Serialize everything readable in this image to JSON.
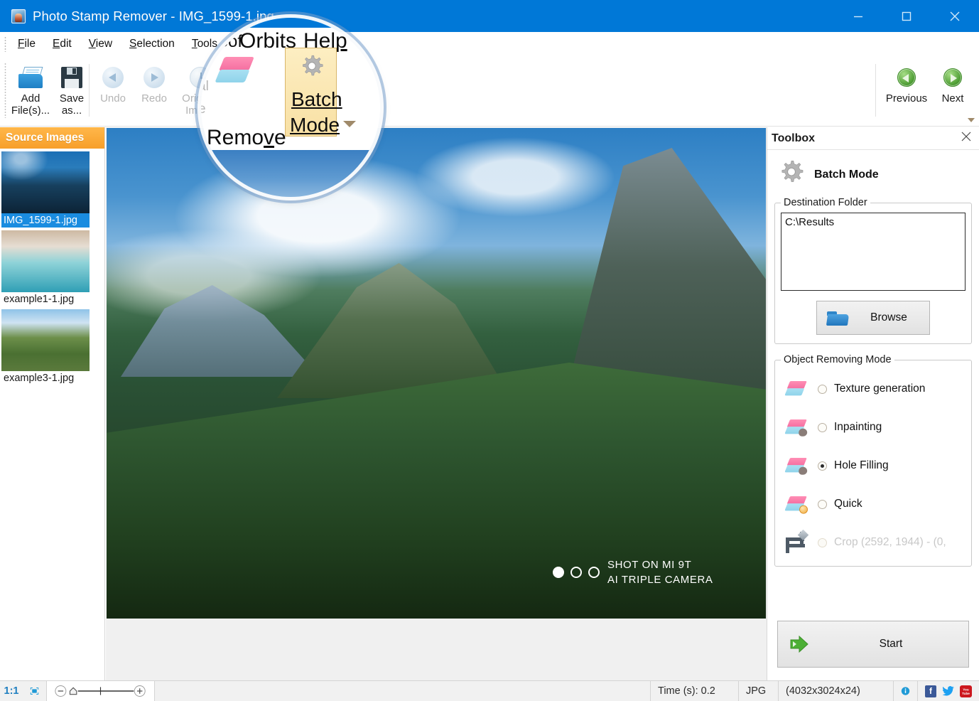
{
  "window": {
    "title": "Photo Stamp Remover - IMG_1599-1.jpg",
    "icon": "app-photo-icon",
    "minimize": "minimize-icon",
    "maximize": "maximize-icon",
    "close": "close-icon",
    "titlebar_color": "#0078d7"
  },
  "menu": {
    "items": [
      {
        "label": "File",
        "accel": "F"
      },
      {
        "label": "Edit",
        "accel": "E"
      },
      {
        "label": "View",
        "accel": "V"
      },
      {
        "label": "Selection",
        "accel": "S"
      },
      {
        "label": "Tools",
        "accel": "T"
      },
      {
        "label": "SoftOrbits",
        "accel": ""
      },
      {
        "label": "Help",
        "accel": "H"
      }
    ]
  },
  "ribbon": {
    "buttons": [
      {
        "name": "add-files",
        "label": "Add\nFile(s)...",
        "icon": "add-files-icon",
        "disabled": false
      },
      {
        "name": "save-as",
        "label": "Save\nas...",
        "icon": "save-icon",
        "disabled": false
      },
      {
        "name": "undo",
        "label": "Undo",
        "icon": "undo-arrow-icon",
        "disabled": true
      },
      {
        "name": "redo",
        "label": "Redo",
        "icon": "redo-arrow-icon",
        "disabled": true
      },
      {
        "name": "original-image",
        "label": "Original\nImage",
        "icon": "clock-icon",
        "disabled": true
      },
      {
        "name": "remove",
        "label": "Remove",
        "icon": "eraser-icon",
        "disabled": false
      },
      {
        "name": "batch-mode",
        "label": "Batch\nMode",
        "icon": "gear-icon",
        "disabled": false
      },
      {
        "name": "previous",
        "label": "Previous",
        "icon": "green-left-arrow-icon",
        "disabled": false
      },
      {
        "name": "next",
        "label": "Next",
        "icon": "green-right-arrow-icon",
        "disabled": false
      }
    ],
    "expand": "ribbon-expand-chevron"
  },
  "magnifier": {
    "menu_fragment_left": "s",
    "menu_fragment_soft": "Sof",
    "menu_orbits": "Orbits",
    "menu_help": "Help",
    "ghost_original": "al",
    "ghost_image": "e",
    "remove_label": "Remove",
    "batch_line1": "Batch",
    "batch_line2": "Mode"
  },
  "source_panel": {
    "header": "Source Images",
    "items": [
      {
        "label": "IMG_1599-1.jpg",
        "selected": true,
        "thumb": "th1"
      },
      {
        "label": "example1-1.jpg",
        "selected": false,
        "thumb": "th2"
      },
      {
        "label": "example3-1.jpg",
        "selected": false,
        "thumb": "th3"
      }
    ]
  },
  "photo": {
    "watermark_line1": "SHOT ON MI 9T",
    "watermark_line2": "AI TRIPLE CAMERA",
    "dots": [
      true,
      false,
      false
    ]
  },
  "toolbox": {
    "title": "Toolbox",
    "close_icon": "close-icon",
    "mode_icon": "gear-icon",
    "mode_name": "Batch Mode",
    "destination": {
      "legend": "Destination Folder",
      "value": "C:\\Results",
      "browse_label": "Browse",
      "browse_icon": "folder-icon"
    },
    "object_removing_mode": {
      "legend": "Object Removing Mode",
      "options": [
        {
          "label": "Texture generation",
          "selected": false,
          "disabled": false,
          "icon": "eraser-icon"
        },
        {
          "label": "Inpainting",
          "selected": false,
          "disabled": false,
          "icon": "eraser-blob-icon"
        },
        {
          "label": "Hole Filling",
          "selected": true,
          "disabled": false,
          "icon": "eraser-blob-icon"
        },
        {
          "label": "Quick",
          "selected": false,
          "disabled": false,
          "icon": "eraser-clock-icon"
        },
        {
          "label": "Crop (2592, 1944) - (0,",
          "selected": false,
          "disabled": true,
          "icon": "crop-icon"
        }
      ]
    },
    "start": {
      "label": "Start",
      "icon": "green-double-arrow-icon"
    }
  },
  "statusbar": {
    "zoom_ratio": "1:1",
    "fit_icon": "fit-to-window-icon",
    "zoom_out_icon": "zoom-out-icon",
    "zoom_handle_icon": "zoom-slider-handle",
    "zoom_in_icon": "zoom-in-icon",
    "time": "Time (s): 0.2",
    "format": "JPG",
    "dimensions": "(4032x3024x24)",
    "info_icon": "info-icon",
    "social": [
      {
        "name": "facebook-icon",
        "glyph": "f"
      },
      {
        "name": "twitter-icon",
        "glyph": "✉"
      },
      {
        "name": "youtube-icon",
        "glyph": "You"
      }
    ]
  },
  "colors": {
    "accent": "#0078d7",
    "source_header": "#f79f2a",
    "selection": "#1a8ce0",
    "green": "#4f9e35"
  }
}
